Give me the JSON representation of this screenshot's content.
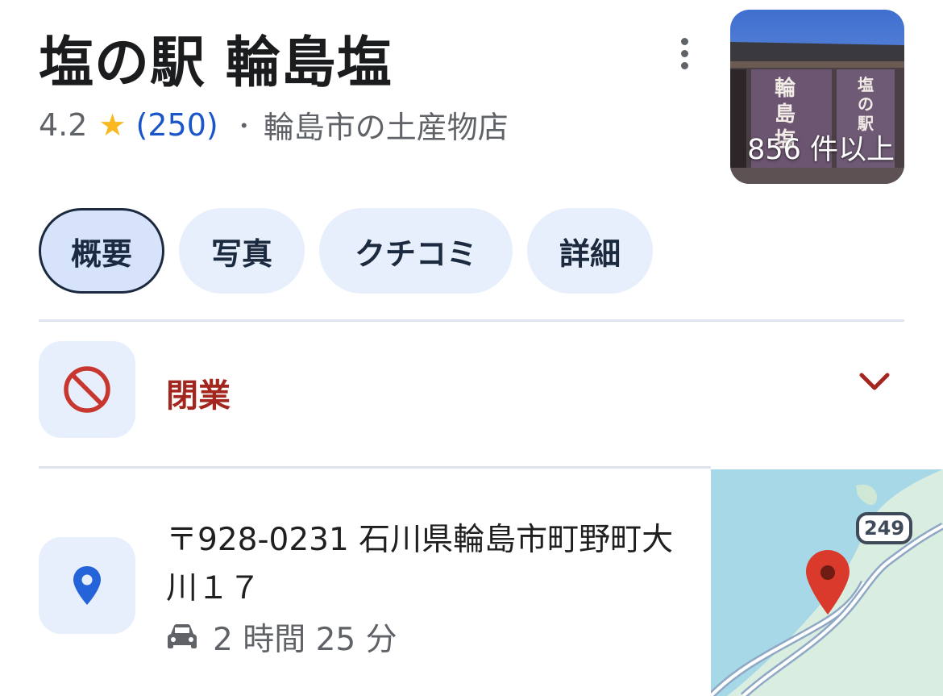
{
  "place": {
    "title": "塩の駅 輪島塩",
    "rating": "4.2",
    "review_count": "(250)",
    "separator": "・",
    "category": "輪島市の土産物店"
  },
  "photo": {
    "count_label": "856 件以上",
    "banner_left_text": "輪島塩",
    "banner_right_text": "塩の駅"
  },
  "tabs": [
    {
      "label": "概要",
      "active": true
    },
    {
      "label": "写真",
      "active": false
    },
    {
      "label": "クチコミ",
      "active": false
    },
    {
      "label": "詳細",
      "active": false
    }
  ],
  "status": {
    "label": "閉業",
    "color": "#a3261f"
  },
  "address": {
    "text": "〒928-0231 石川県輪島市町野町大川１７",
    "drive_time": "2 時間 25 分"
  },
  "map": {
    "route_number": "249"
  },
  "icons": {
    "more": "more-vert-icon",
    "closed": "block-icon",
    "expand": "chevron-down-icon",
    "location": "location-pin-icon",
    "drive": "car-icon",
    "map_marker": "map-marker-icon"
  },
  "colors": {
    "accent_blue": "#1a56c8",
    "star": "#f9b820",
    "status_red": "#a3261f",
    "chip_bg": "#e8effc"
  }
}
